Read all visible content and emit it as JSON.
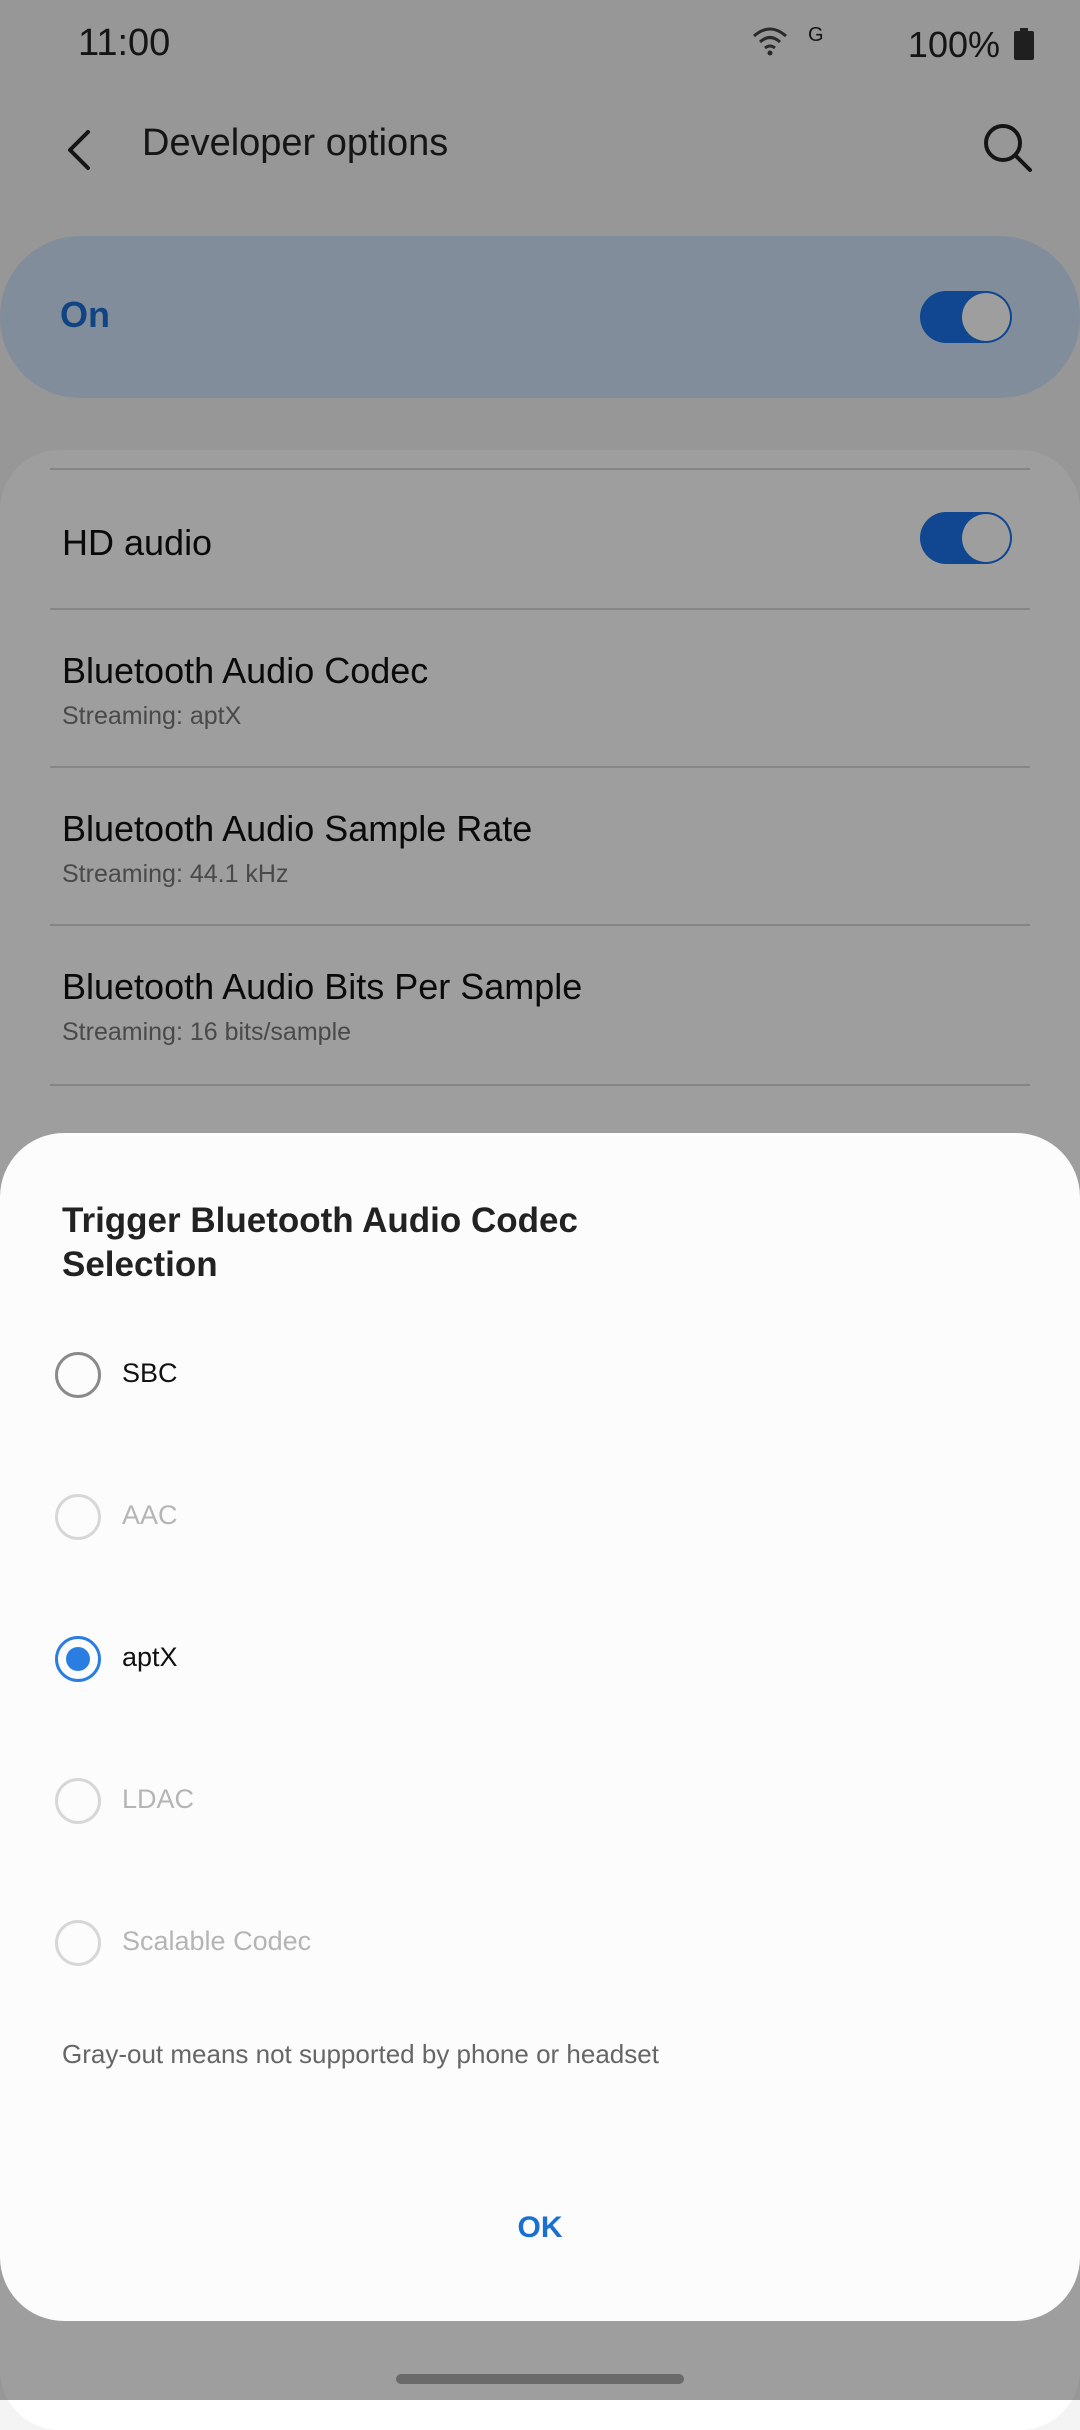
{
  "status": {
    "time": "11:00",
    "network": "G",
    "battery": "100%"
  },
  "appbar": {
    "title": "Developer options"
  },
  "master_switch": {
    "label": "On",
    "on": true
  },
  "rows": [
    {
      "title": "HD audio",
      "toggle": true
    },
    {
      "title": "Bluetooth Audio Codec",
      "subtitle": "Streaming: aptX"
    },
    {
      "title": "Bluetooth Audio Sample Rate",
      "subtitle": "Streaming: 44.1 kHz"
    },
    {
      "title": "Bluetooth Audio Bits Per Sample",
      "subtitle": "Streaming: 16 bits/sample"
    }
  ],
  "dialog": {
    "title": "Trigger Bluetooth Audio Codec Selection",
    "options": [
      {
        "label": "SBC",
        "enabled": true,
        "selected": false
      },
      {
        "label": "AAC",
        "enabled": false,
        "selected": false
      },
      {
        "label": "aptX",
        "enabled": true,
        "selected": true
      },
      {
        "label": "LDAC",
        "enabled": false,
        "selected": false
      },
      {
        "label": "Scalable Codec",
        "enabled": false,
        "selected": false
      }
    ],
    "note": "Gray-out means not supported by phone or headset",
    "ok": "OK"
  },
  "colors": {
    "accent": "#1a73e8",
    "radio_selected": "#2a7de1"
  }
}
